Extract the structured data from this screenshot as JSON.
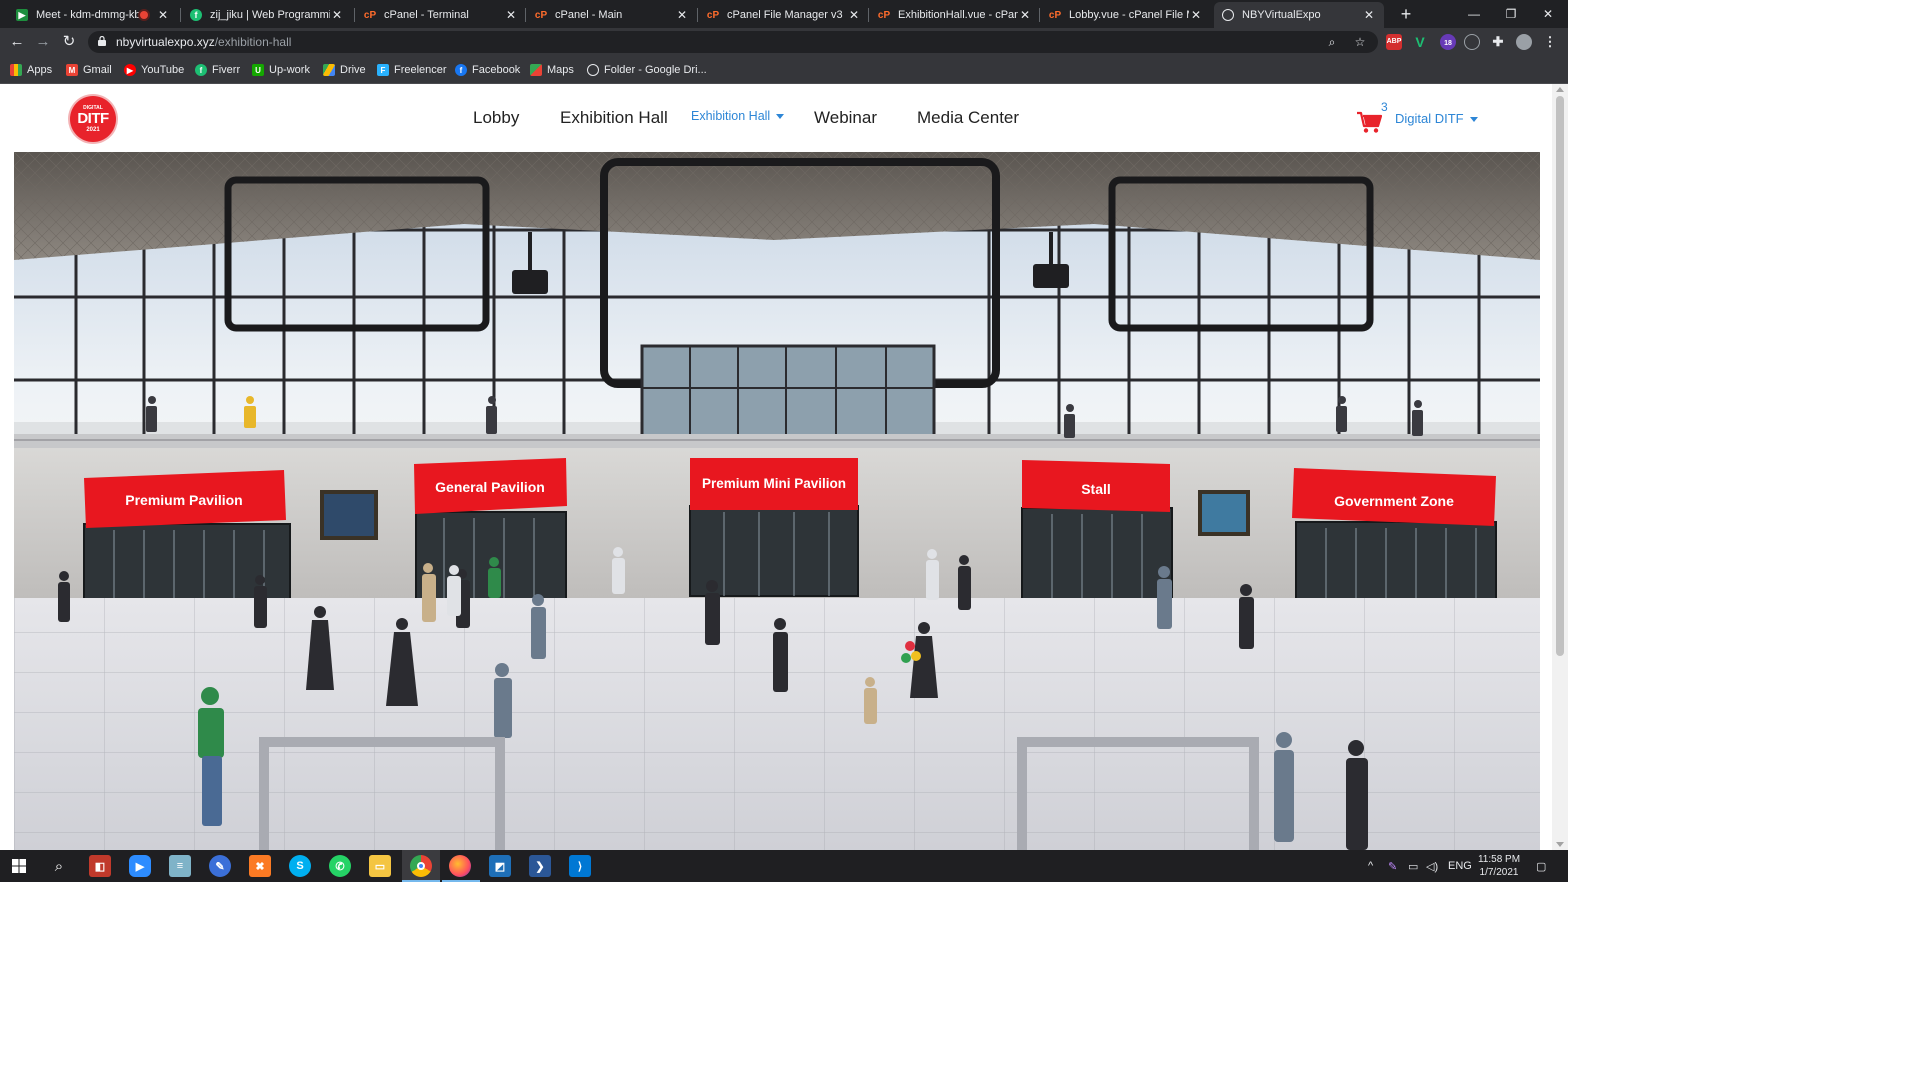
{
  "browser": {
    "tabs": [
      {
        "title": "Meet - kdm-dmmg-kbt",
        "icon": "google-meet-icon",
        "color": "#1e8e3e"
      },
      {
        "title": "zij_jiku | Web Programming",
        "icon": "fiverr-icon",
        "color": "#1dbf73"
      },
      {
        "title": "cPanel - Terminal",
        "icon": "cpanel-icon",
        "color": "#ff6c2c"
      },
      {
        "title": "cPanel - Main",
        "icon": "cpanel-icon",
        "color": "#ff6c2c"
      },
      {
        "title": "cPanel File Manager v3",
        "icon": "cpanel-icon",
        "color": "#ff6c2c"
      },
      {
        "title": "ExhibitionHall.vue - cPanel F",
        "icon": "cpanel-icon",
        "color": "#ff6c2c"
      },
      {
        "title": "Lobby.vue - cPanel File Man",
        "icon": "cpanel-icon",
        "color": "#ff6c2c"
      },
      {
        "title": "NBYVirtualExpo",
        "icon": "globe-icon",
        "color": "#9aa0a6"
      }
    ],
    "active_tab": 7,
    "url_host": "nbyvirtualexpo.xyz",
    "url_path": "/exhibition-hall",
    "extension_badge": "18",
    "bookmarks": [
      {
        "label": "Apps",
        "icon": "apps-grid-icon",
        "color": "#4285f4"
      },
      {
        "label": "Gmail",
        "icon": "gmail-icon",
        "color": "#ea4335"
      },
      {
        "label": "YouTube",
        "icon": "youtube-icon",
        "color": "#ff0000"
      },
      {
        "label": "Fiverr",
        "icon": "fiverr-icon",
        "color": "#1dbf73"
      },
      {
        "label": "Up-work",
        "icon": "upwork-icon",
        "color": "#14a800"
      },
      {
        "label": "Drive",
        "icon": "google-drive-icon",
        "color": "#fbbc04"
      },
      {
        "label": "Freelencer",
        "icon": "freelancer-icon",
        "color": "#29b2fe"
      },
      {
        "label": "Facebook",
        "icon": "facebook-icon",
        "color": "#1877f2"
      },
      {
        "label": "Maps",
        "icon": "google-maps-icon",
        "color": "#34a853"
      },
      {
        "label": "Folder - Google Dri...",
        "icon": "folder-icon",
        "color": "#9aa0a6"
      }
    ]
  },
  "site": {
    "logo": {
      "top": "DIGITAL",
      "mid": "DITF",
      "year": "2021"
    },
    "nav": {
      "lobby": "Lobby",
      "exhibition_hall": "Exhibition Hall",
      "exhibition_dropdown": "Exhibition Hall",
      "webinar": "Webinar",
      "media_center": "Media Center"
    },
    "cart_count": "3",
    "user_menu": "Digital DITF",
    "accent_color": "#2d86d6",
    "brand_red": "#e8232b"
  },
  "hall": {
    "signs": [
      "Premium Pavilion",
      "General Pavilion",
      "Premium Mini Pavilion",
      "Stall",
      "Government Zone"
    ]
  },
  "taskbar": {
    "apps": [
      "start-icon",
      "search-icon",
      "paint-icon",
      "zoom-icon",
      "notepad-icon",
      "pen-icon",
      "xampp-icon",
      "skype-icon",
      "whatsapp-icon",
      "file-explorer-icon",
      "chrome-icon",
      "firefox-icon",
      "photos-icon",
      "powershell-icon",
      "vscode-icon"
    ],
    "language": "ENG",
    "time": "11:58 PM",
    "date": "1/7/2021"
  }
}
